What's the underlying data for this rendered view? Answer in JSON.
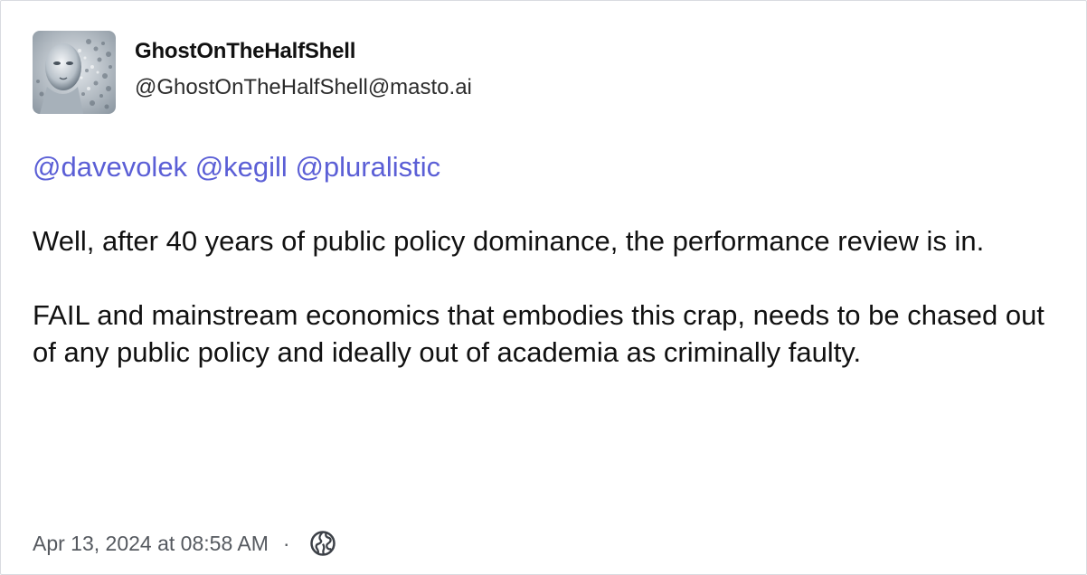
{
  "author": {
    "display_name": "GhostOnTheHalfShell",
    "handle": "@GhostOnTheHalfShell@masto.ai"
  },
  "post": {
    "mentions": [
      "@davevolek",
      "@kegill",
      "@pluralistic"
    ],
    "paragraphs": [
      "Well, after 40 years of public policy dominance, the performance review is in.",
      "FAIL and mainstream economics that embodies this crap, needs to be chased out of any public policy and ideally out of academia as criminally faulty."
    ]
  },
  "meta": {
    "timestamp": "Apr 13, 2024 at 08:58 AM",
    "separator": "·",
    "visibility_icon": "globe-icon"
  },
  "colors": {
    "mention": "#5b5fd6",
    "text": "#111111",
    "meta": "#55595f",
    "border": "#d9dbe0"
  }
}
